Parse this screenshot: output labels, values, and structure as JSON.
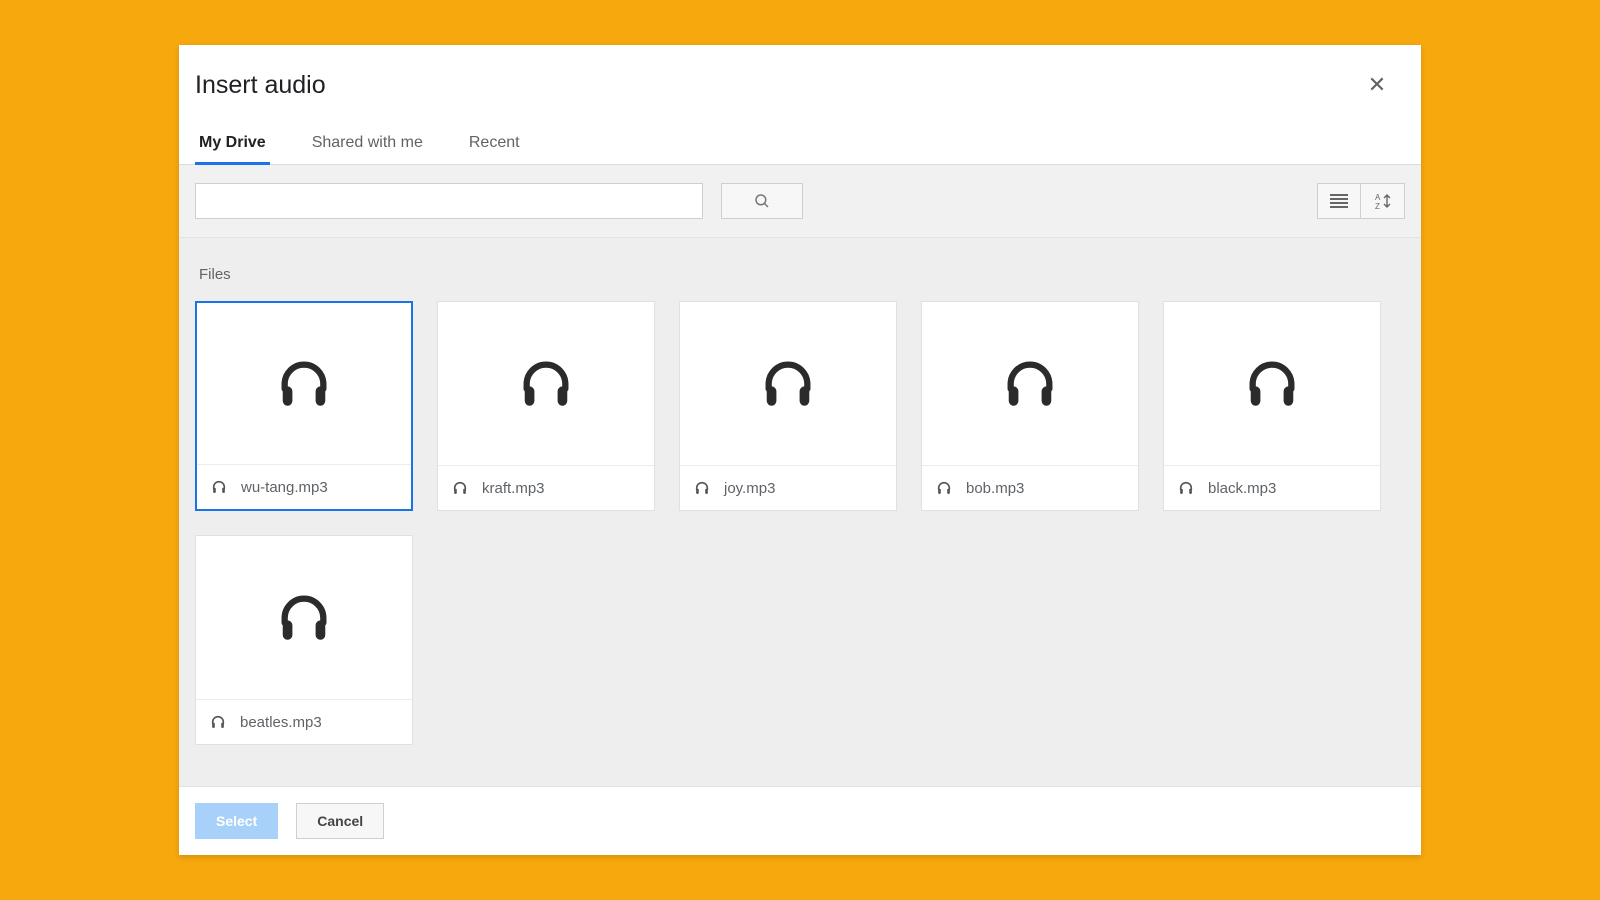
{
  "title": "Insert audio",
  "tabs": [
    "My Drive",
    "Shared with me",
    "Recent"
  ],
  "active_tab": 0,
  "section_label": "Files",
  "search": {
    "value": ""
  },
  "files": [
    {
      "name": "wu-tang.mp3",
      "selected": true
    },
    {
      "name": "kraft.mp3",
      "selected": false
    },
    {
      "name": "joy.mp3",
      "selected": false
    },
    {
      "name": "bob.mp3",
      "selected": false
    },
    {
      "name": "black.mp3",
      "selected": false
    },
    {
      "name": "beatles.mp3",
      "selected": false
    }
  ],
  "buttons": {
    "select": "Select",
    "cancel": "Cancel"
  }
}
